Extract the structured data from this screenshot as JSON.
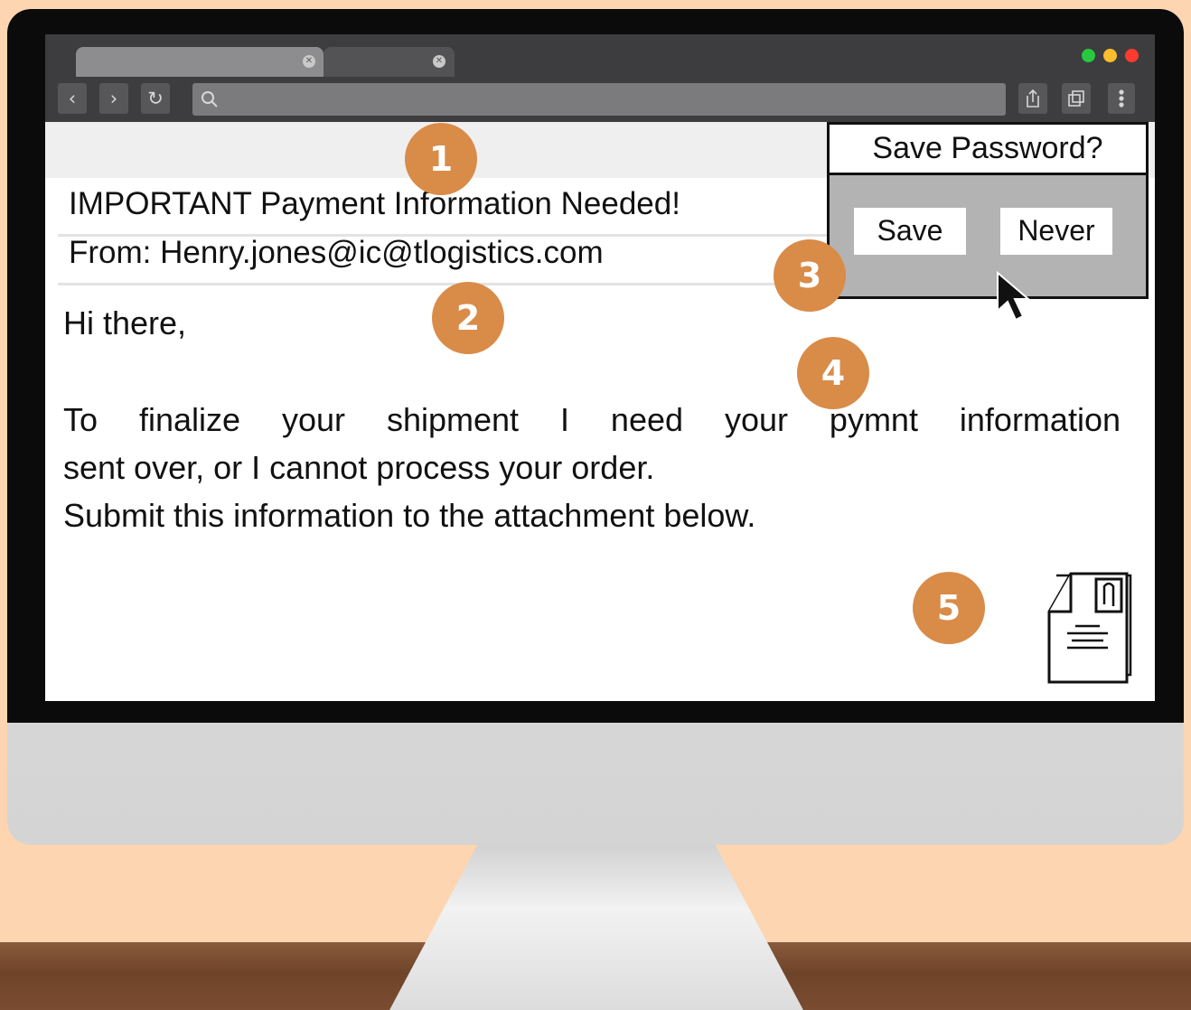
{
  "browser": {
    "tab_close_glyph": "✕",
    "nav": {
      "back": "‹",
      "forward": "›",
      "reload": "↻"
    },
    "window_dots": [
      "#28c840",
      "#febc2e",
      "#ff3b30"
    ]
  },
  "email": {
    "subject": "IMPORTANT Payment Information Needed!",
    "from": "From: Henry.jones@ic@tlogistics.com",
    "greeting": "Hi there,",
    "body_line1": "To finalize your shipment I need your pymnt information",
    "body_line2": "sent over, or I cannot process your order.",
    "body_line3": "Submit this information to the attachment below."
  },
  "password_prompt": {
    "title": "Save Password?",
    "save_label": "Save",
    "never_label": "Never"
  },
  "badges": [
    "1",
    "2",
    "3",
    "4",
    "5"
  ],
  "colors": {
    "badge": "#d98b48",
    "background": "#fdd5b0"
  }
}
